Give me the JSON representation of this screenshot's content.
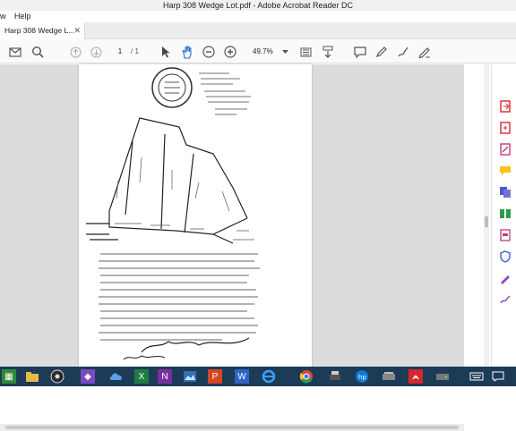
{
  "window": {
    "title": "Harp 308 Wedge Lot.pdf - Adobe Acrobat Reader DC"
  },
  "menu": {
    "items": [
      "w",
      "Help"
    ]
  },
  "tabs": [
    {
      "label": "Harp 308 Wedge L..."
    }
  ],
  "toolbar": {
    "current_page": "1",
    "page_total": "/ 1",
    "zoom": "49.7%"
  },
  "page": {
    "stamp_text": "REGISTERED PROFESSIONAL LAND SURVEYOR",
    "header_lines": [
      "FOR USE F. BENEDICT, RPS",
      "LARRY DIBERNARDO",
      "PROPERTY ADDRESS",
      "SUBDIVISION LOT-153",
      "TRACTS A, B & C"
    ],
    "tract_labels": [
      "TRACT - A",
      "TRACT - B",
      "TRACT - C"
    ],
    "signature_text": "Plot on Drawing as Kapleff",
    "legend_text": "L = Length"
  },
  "colors": {
    "accent": "#d8262e",
    "taskbar": "#1c3b57"
  }
}
